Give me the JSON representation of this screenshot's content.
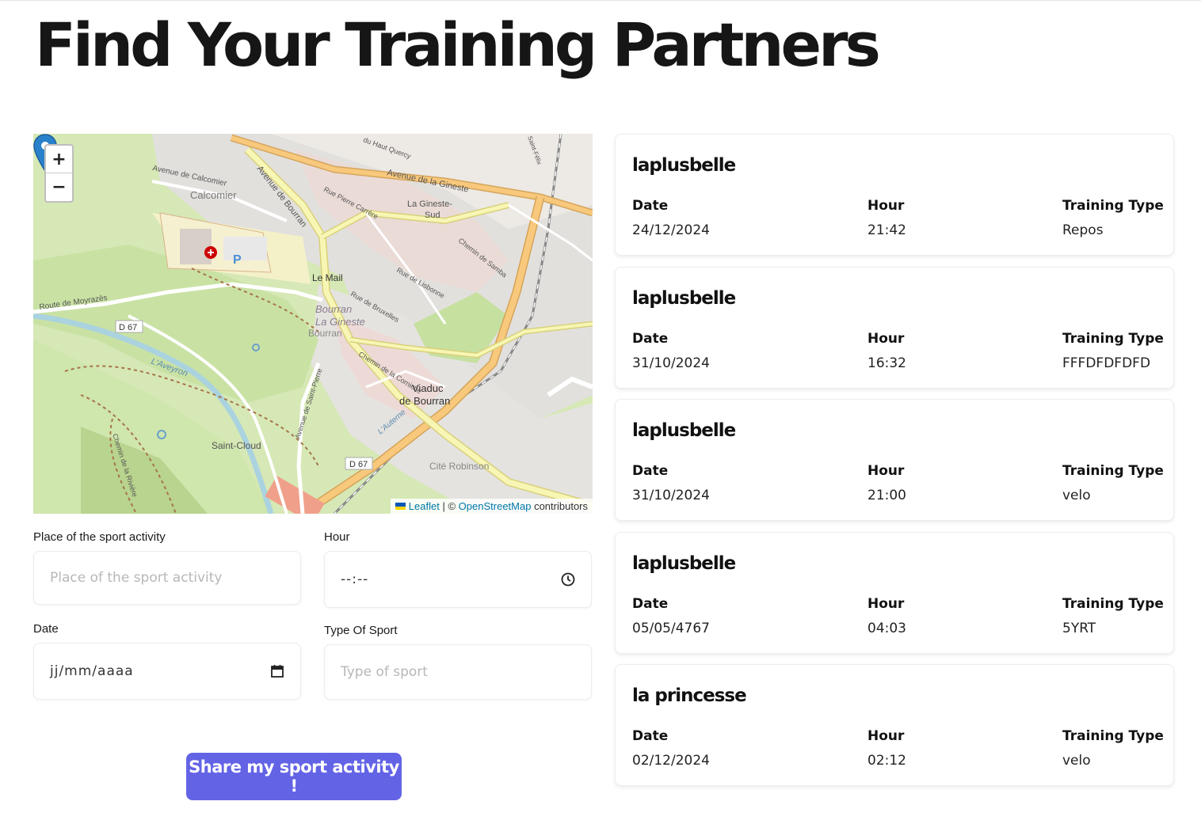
{
  "page": {
    "title": "Find Your Training Partners"
  },
  "map": {
    "zoom_in": "+",
    "zoom_out": "−",
    "attribution": {
      "leaflet": "Leaflet",
      "separator": "| ©",
      "osm": "OpenStreetMap",
      "suffix": "contributors"
    },
    "labels": {
      "calcomier_ave": "Avenue de Calcomier",
      "calcomier": "Calcomier",
      "bourran_ave": "Avenue de Bourran",
      "gineste_ave": "Avenue de la Gineste",
      "haut_quercy": "du Haut Quercy",
      "pierre_carrere": "Rue Pierre Carrère",
      "gineste_sud": "La Gineste-",
      "gineste_sud2": "Sud",
      "saint_felix": "Saint-Félix",
      "samba": "Chemin de Samba",
      "lisbonne": "Rue de Lisbonne",
      "bruxelles": "Rue de Bruxelles",
      "le_mail": "Le Mail",
      "bourran_area": "Bourran",
      "la_gineste": "La Gineste",
      "bourran_small": "Bourran",
      "moyrazes": "Route de Moyrazès",
      "d67_a": "D 67",
      "aveyron": "L'Aveyron",
      "corniche": "Chemin de la Corniche",
      "viaduc": "Viaduc",
      "viaduc2": "de Bourran",
      "saint_pierre": "Avenue de Saint-Pierre",
      "saint_cloud": "Saint-Cloud",
      "riviere": "Chemin de la Rivière",
      "d67_b": "D 67",
      "cite_robinson": "Cité Robinson",
      "lauterne": "L'Auterne"
    }
  },
  "form": {
    "place_label": "Place of the sport activity",
    "place_placeholder": "Place of the sport activity",
    "hour_label": "Hour",
    "hour_value": "--:--",
    "date_label": "Date",
    "date_value": "jj/mm/aaaa",
    "sport_label": "Type Of Sport",
    "sport_placeholder": "Type of sport",
    "submit": "Share my sport activity !"
  },
  "card_headers": {
    "date": "Date",
    "hour": "Hour",
    "type": "Training Type"
  },
  "activities": [
    {
      "user": "laplusbelle",
      "date": "24/12/2024",
      "hour": "21:42",
      "type": "Repos"
    },
    {
      "user": "laplusbelle",
      "date": "31/10/2024",
      "hour": "16:32",
      "type": "FFFDFDFDFD"
    },
    {
      "user": "laplusbelle",
      "date": "31/10/2024",
      "hour": "21:00",
      "type": "velo"
    },
    {
      "user": "laplusbelle",
      "date": "05/05/4767",
      "hour": "04:03",
      "type": "5YRT"
    },
    {
      "user": "la princesse",
      "date": "02/12/2024",
      "hour": "02:12",
      "type": "velo"
    }
  ],
  "colors": {
    "accent": "#6363e6",
    "map_marker": "#2a81cb",
    "map_park": "#d6e8b5",
    "map_urban": "#e0dfdf"
  }
}
